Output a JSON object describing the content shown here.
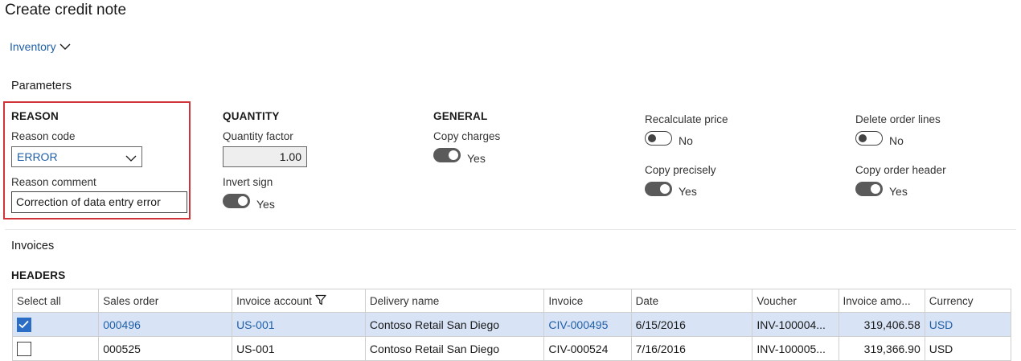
{
  "title": "Create credit note",
  "nav": {
    "label": "Inventory"
  },
  "parameters": {
    "heading": "Parameters",
    "reason": {
      "group": "REASON",
      "code_label": "Reason code",
      "code_value": "ERROR",
      "comment_label": "Reason comment",
      "comment_value": "Correction of data entry error"
    },
    "quantity": {
      "group": "QUANTITY",
      "factor_label": "Quantity factor",
      "factor_value": "1.00",
      "invert_label": "Invert sign",
      "invert_state": "Yes"
    },
    "general": {
      "group": "GENERAL",
      "copy_charges_label": "Copy charges",
      "copy_charges_state": "Yes"
    },
    "options": {
      "recalc_label": "Recalculate price",
      "recalc_state": "No",
      "copy_precisely_label": "Copy precisely",
      "copy_precisely_state": "Yes",
      "delete_lines_label": "Delete order lines",
      "delete_lines_state": "No",
      "copy_header_label": "Copy order header",
      "copy_header_state": "Yes"
    }
  },
  "invoices": {
    "heading": "Invoices",
    "subheading": "HEADERS",
    "columns": [
      "Select all",
      "Sales order",
      "Invoice account",
      "Delivery name",
      "Invoice",
      "Date",
      "Voucher",
      "Invoice amo...",
      "Currency"
    ],
    "rows": [
      {
        "checked": true,
        "sales_order": "000496",
        "account": "US-001",
        "delivery": "Contoso Retail San Diego",
        "invoice": "CIV-000495",
        "date": "6/15/2016",
        "voucher": "INV-100004...",
        "amount": "319,406.58",
        "currency": "USD"
      },
      {
        "checked": false,
        "sales_order": "000525",
        "account": "US-001",
        "delivery": "Contoso Retail San Diego",
        "invoice": "CIV-000524",
        "date": "7/16/2016",
        "voucher": "INV-100005...",
        "amount": "319,366.90",
        "currency": "USD"
      }
    ]
  },
  "colors": {
    "link": "#1f5fa8",
    "highlight": "#d13438",
    "selected_row": "#d8e4f6",
    "checkbox": "#2b6cc4"
  },
  "icons": {
    "nav": "chevron-down-icon",
    "select": "chevron-down-icon",
    "filter": "filter-icon",
    "check": "checkmark-icon"
  }
}
